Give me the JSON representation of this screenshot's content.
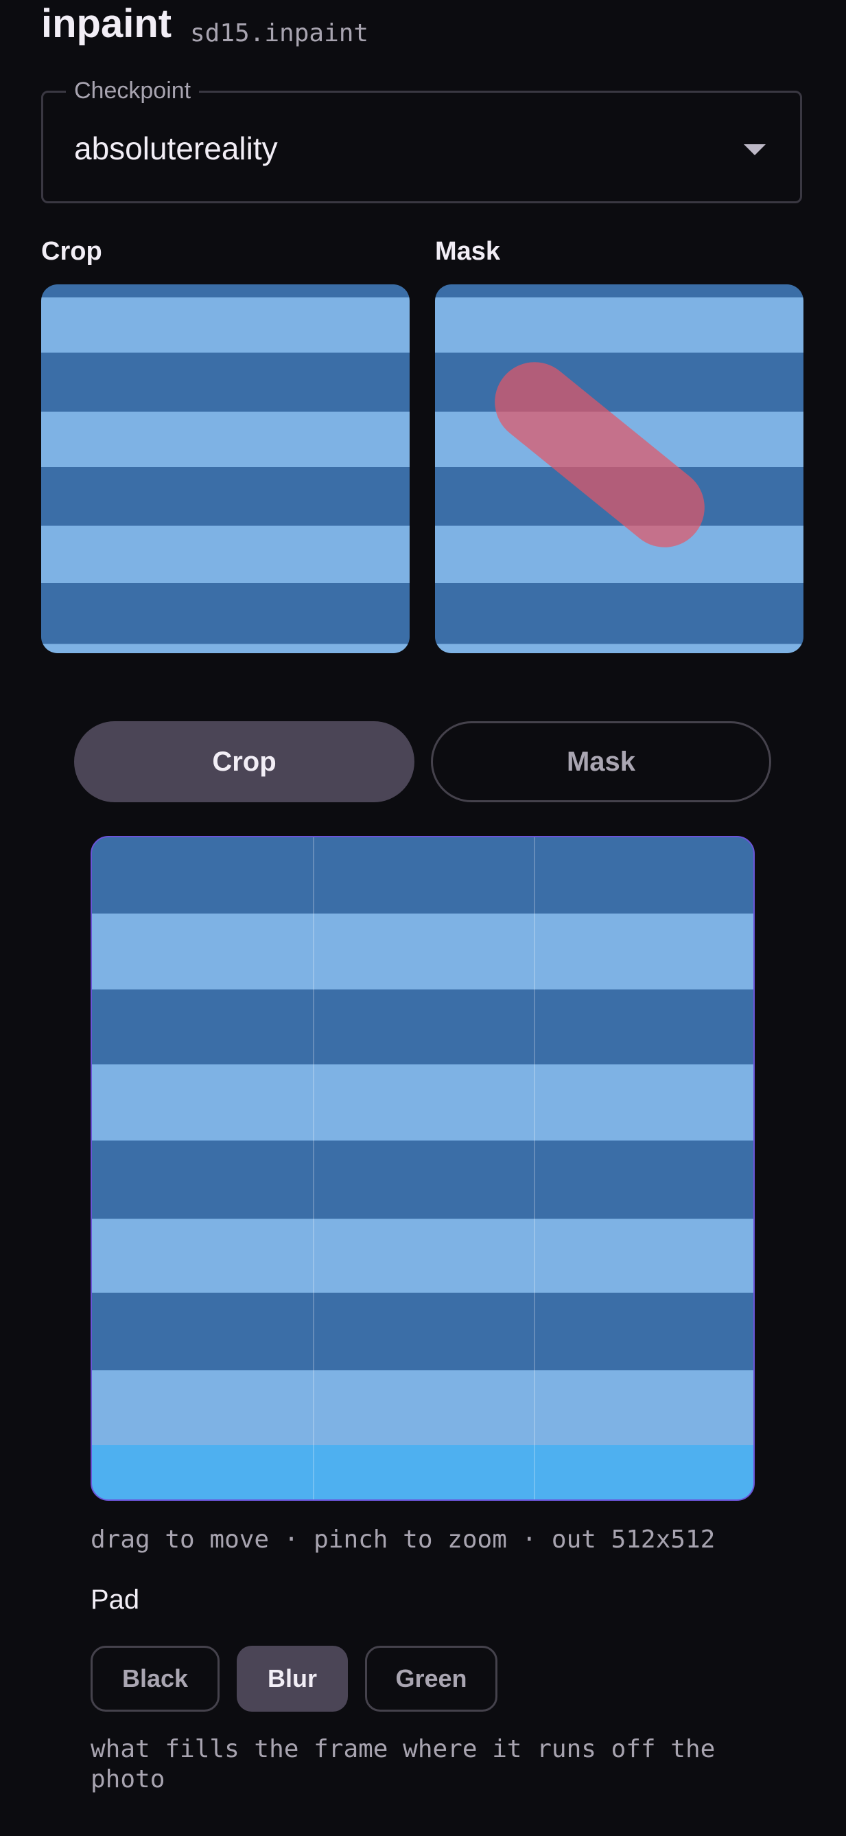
{
  "header": {
    "title": "inpaint",
    "subtitle": "sd15.inpaint"
  },
  "checkpoint": {
    "label": "Checkpoint",
    "value": "absolutereality"
  },
  "previews": {
    "crop_label": "Crop",
    "mask_label": "Mask"
  },
  "mode_toggle": {
    "crop_label": "Crop",
    "mask_label": "Mask",
    "selected": "Crop"
  },
  "editor": {
    "hint": "drag to move · pinch to zoom · out 512x512"
  },
  "pad": {
    "label": "Pad",
    "options": [
      "Black",
      "Blur",
      "Green"
    ],
    "selected": "Blur",
    "description": "what fills the frame where it runs off the photo"
  },
  "colors": {
    "accent": "#6b55d8",
    "mask": "#e05868",
    "selected_bg": "#4b4556"
  }
}
